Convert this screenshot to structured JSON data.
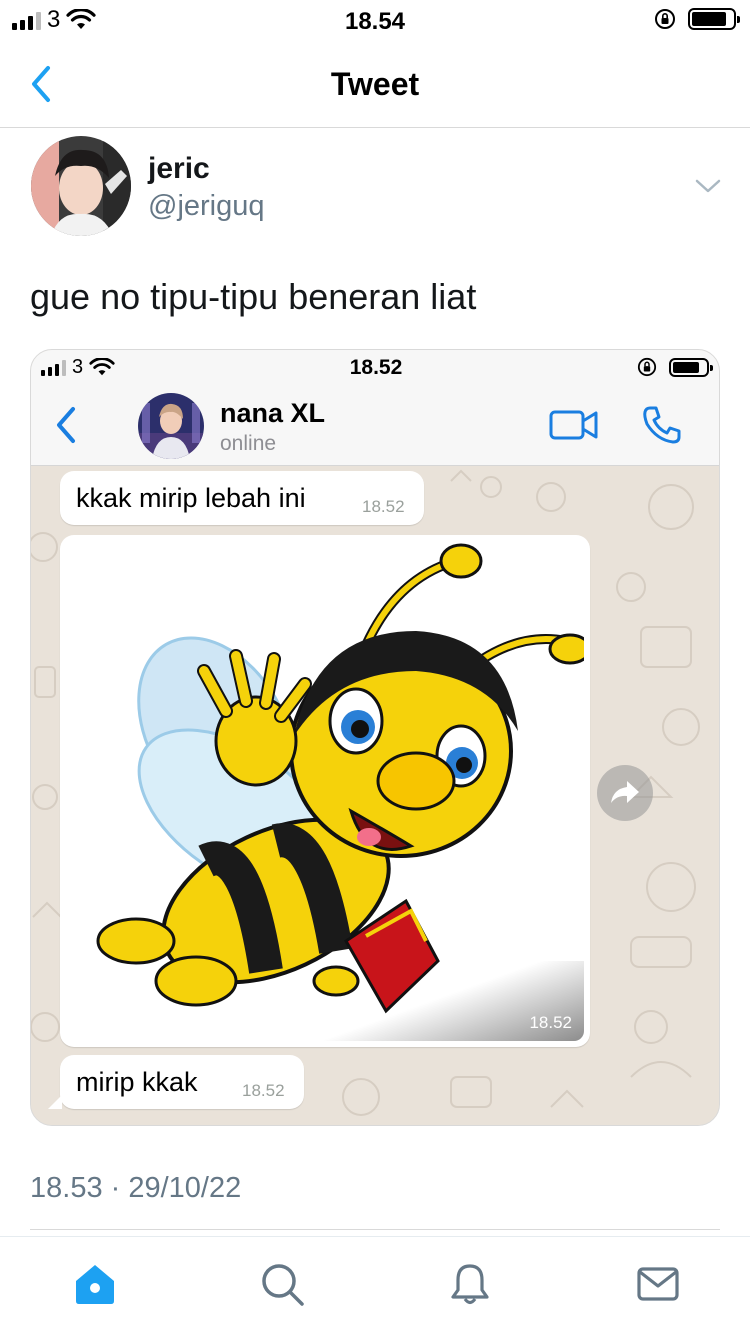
{
  "status_bar": {
    "carrier": "3",
    "time": "18.54",
    "signal_bars_on": 3,
    "battery_level": 0.85
  },
  "header": {
    "title": "Tweet",
    "back_icon": "chevron-left-icon",
    "accent": "#1da1f2"
  },
  "tweet": {
    "author_name": "jeric",
    "author_handle": "@jeriguq",
    "text": "gue no tipu-tipu beneran liat",
    "timestamp": "18.53 · 29/10/22",
    "menu_icon": "chevron-down-icon"
  },
  "embedded_screenshot": {
    "status_bar": {
      "carrier": "3",
      "time": "18.52",
      "battery_level": 0.8
    },
    "chat_header": {
      "contact_name": "nana XL",
      "status": "online",
      "video_icon": "video-call-icon",
      "call_icon": "phone-icon"
    },
    "messages": [
      {
        "text": "kkak mirip lebah ini",
        "time": "18.52"
      },
      {
        "type": "image",
        "image_icon": "cartoon-bee-image",
        "time": "18.52"
      },
      {
        "text": "mirip kkak",
        "time": "18.52"
      }
    ],
    "forward_icon": "forward-icon",
    "wa_accent": "#1a7ee0"
  },
  "tab_bar": [
    {
      "icon": "home-icon",
      "active": true
    },
    {
      "icon": "search-icon",
      "active": false
    },
    {
      "icon": "bell-icon",
      "active": false
    },
    {
      "icon": "mail-icon",
      "active": false
    }
  ]
}
